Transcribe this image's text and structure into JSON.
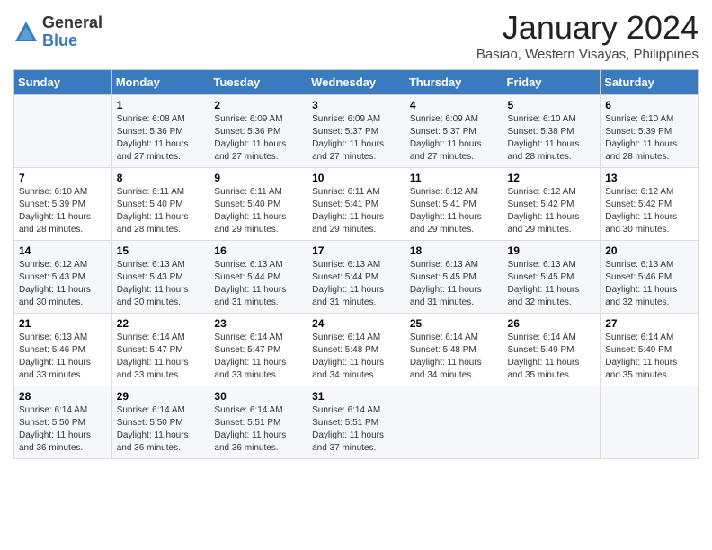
{
  "logo": {
    "general": "General",
    "blue": "Blue"
  },
  "title": "January 2024",
  "subtitle": "Basiao, Western Visayas, Philippines",
  "days_header": [
    "Sunday",
    "Monday",
    "Tuesday",
    "Wednesday",
    "Thursday",
    "Friday",
    "Saturday"
  ],
  "weeks": [
    [
      {
        "day": "",
        "info": ""
      },
      {
        "day": "1",
        "info": "Sunrise: 6:08 AM\nSunset: 5:36 PM\nDaylight: 11 hours\nand 27 minutes."
      },
      {
        "day": "2",
        "info": "Sunrise: 6:09 AM\nSunset: 5:36 PM\nDaylight: 11 hours\nand 27 minutes."
      },
      {
        "day": "3",
        "info": "Sunrise: 6:09 AM\nSunset: 5:37 PM\nDaylight: 11 hours\nand 27 minutes."
      },
      {
        "day": "4",
        "info": "Sunrise: 6:09 AM\nSunset: 5:37 PM\nDaylight: 11 hours\nand 27 minutes."
      },
      {
        "day": "5",
        "info": "Sunrise: 6:10 AM\nSunset: 5:38 PM\nDaylight: 11 hours\nand 28 minutes."
      },
      {
        "day": "6",
        "info": "Sunrise: 6:10 AM\nSunset: 5:39 PM\nDaylight: 11 hours\nand 28 minutes."
      }
    ],
    [
      {
        "day": "7",
        "info": "Sunrise: 6:10 AM\nSunset: 5:39 PM\nDaylight: 11 hours\nand 28 minutes."
      },
      {
        "day": "8",
        "info": "Sunrise: 6:11 AM\nSunset: 5:40 PM\nDaylight: 11 hours\nand 28 minutes."
      },
      {
        "day": "9",
        "info": "Sunrise: 6:11 AM\nSunset: 5:40 PM\nDaylight: 11 hours\nand 29 minutes."
      },
      {
        "day": "10",
        "info": "Sunrise: 6:11 AM\nSunset: 5:41 PM\nDaylight: 11 hours\nand 29 minutes."
      },
      {
        "day": "11",
        "info": "Sunrise: 6:12 AM\nSunset: 5:41 PM\nDaylight: 11 hours\nand 29 minutes."
      },
      {
        "day": "12",
        "info": "Sunrise: 6:12 AM\nSunset: 5:42 PM\nDaylight: 11 hours\nand 29 minutes."
      },
      {
        "day": "13",
        "info": "Sunrise: 6:12 AM\nSunset: 5:42 PM\nDaylight: 11 hours\nand 30 minutes."
      }
    ],
    [
      {
        "day": "14",
        "info": "Sunrise: 6:12 AM\nSunset: 5:43 PM\nDaylight: 11 hours\nand 30 minutes."
      },
      {
        "day": "15",
        "info": "Sunrise: 6:13 AM\nSunset: 5:43 PM\nDaylight: 11 hours\nand 30 minutes."
      },
      {
        "day": "16",
        "info": "Sunrise: 6:13 AM\nSunset: 5:44 PM\nDaylight: 11 hours\nand 31 minutes."
      },
      {
        "day": "17",
        "info": "Sunrise: 6:13 AM\nSunset: 5:44 PM\nDaylight: 11 hours\nand 31 minutes."
      },
      {
        "day": "18",
        "info": "Sunrise: 6:13 AM\nSunset: 5:45 PM\nDaylight: 11 hours\nand 31 minutes."
      },
      {
        "day": "19",
        "info": "Sunrise: 6:13 AM\nSunset: 5:45 PM\nDaylight: 11 hours\nand 32 minutes."
      },
      {
        "day": "20",
        "info": "Sunrise: 6:13 AM\nSunset: 5:46 PM\nDaylight: 11 hours\nand 32 minutes."
      }
    ],
    [
      {
        "day": "21",
        "info": "Sunrise: 6:13 AM\nSunset: 5:46 PM\nDaylight: 11 hours\nand 33 minutes."
      },
      {
        "day": "22",
        "info": "Sunrise: 6:14 AM\nSunset: 5:47 PM\nDaylight: 11 hours\nand 33 minutes."
      },
      {
        "day": "23",
        "info": "Sunrise: 6:14 AM\nSunset: 5:47 PM\nDaylight: 11 hours\nand 33 minutes."
      },
      {
        "day": "24",
        "info": "Sunrise: 6:14 AM\nSunset: 5:48 PM\nDaylight: 11 hours\nand 34 minutes."
      },
      {
        "day": "25",
        "info": "Sunrise: 6:14 AM\nSunset: 5:48 PM\nDaylight: 11 hours\nand 34 minutes."
      },
      {
        "day": "26",
        "info": "Sunrise: 6:14 AM\nSunset: 5:49 PM\nDaylight: 11 hours\nand 35 minutes."
      },
      {
        "day": "27",
        "info": "Sunrise: 6:14 AM\nSunset: 5:49 PM\nDaylight: 11 hours\nand 35 minutes."
      }
    ],
    [
      {
        "day": "28",
        "info": "Sunrise: 6:14 AM\nSunset: 5:50 PM\nDaylight: 11 hours\nand 36 minutes."
      },
      {
        "day": "29",
        "info": "Sunrise: 6:14 AM\nSunset: 5:50 PM\nDaylight: 11 hours\nand 36 minutes."
      },
      {
        "day": "30",
        "info": "Sunrise: 6:14 AM\nSunset: 5:51 PM\nDaylight: 11 hours\nand 36 minutes."
      },
      {
        "day": "31",
        "info": "Sunrise: 6:14 AM\nSunset: 5:51 PM\nDaylight: 11 hours\nand 37 minutes."
      },
      {
        "day": "",
        "info": ""
      },
      {
        "day": "",
        "info": ""
      },
      {
        "day": "",
        "info": ""
      }
    ]
  ]
}
